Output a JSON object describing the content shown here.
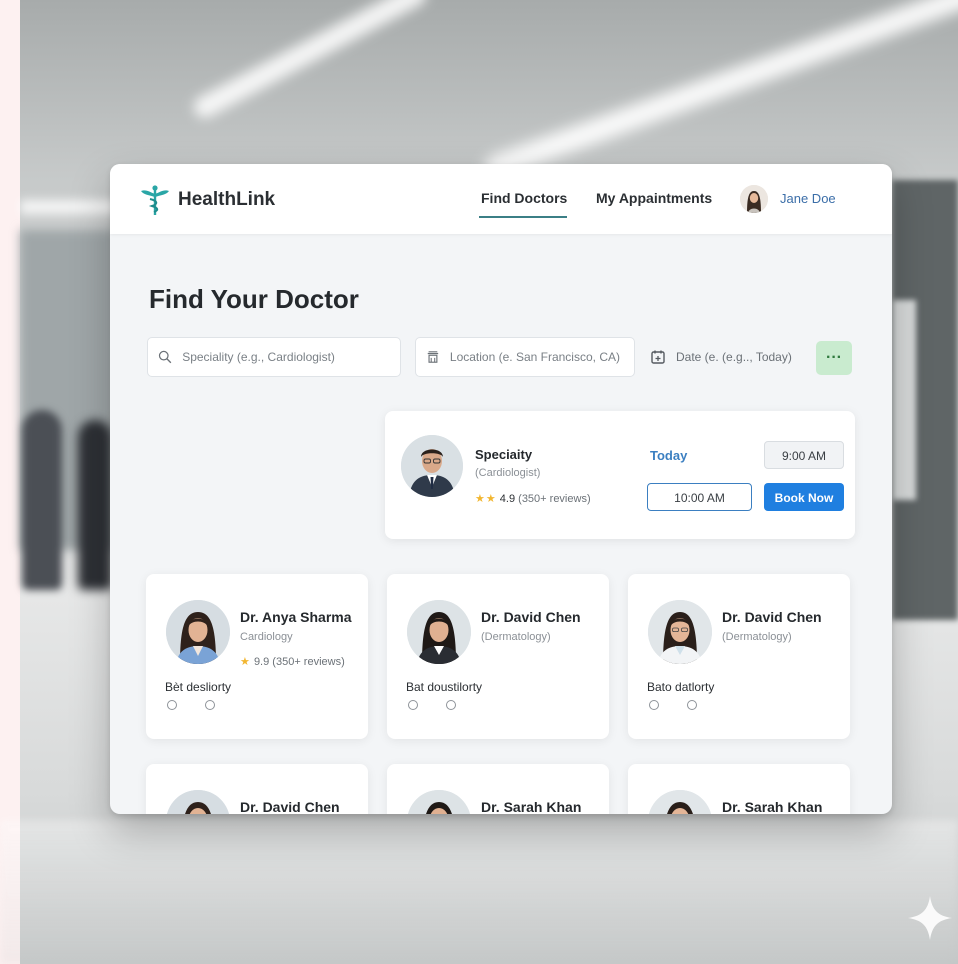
{
  "app": {
    "name": "HealthLink"
  },
  "nav": {
    "items": [
      {
        "label": "Find Doctors",
        "active": true
      },
      {
        "label": "My Appaintments",
        "active": false
      }
    ],
    "user": {
      "name": "Jane Doe"
    }
  },
  "page": {
    "title": "Find Your Doctor"
  },
  "search": {
    "specialty_placeholder": "Speciality (e.g., Cardiologist)",
    "location_placeholder": "Location (e. San Francisco, CA)",
    "date_placeholder": "Date (e. (e.g.., Today)",
    "more_label": "···"
  },
  "featured": {
    "title": "Speciaity",
    "subtitle": "(Cardiologist)",
    "stars": "★★",
    "rating": "4.9",
    "reviews": "(350+ reviews)",
    "day": "Today",
    "slot_1": "9:00 AM",
    "slot_2": "10:00 AM",
    "book_label": "Book Now"
  },
  "doctors": [
    {
      "name": "Dr. Anya Sharma",
      "specialty": "Cardiology",
      "stars": "★",
      "rating": "9.9",
      "reviews": "(350+ reviews)",
      "status": "Bèt desliorty"
    },
    {
      "name": "Dr. David Chen",
      "specialty": "(Dermatology)",
      "status": "Bat doustilorty"
    },
    {
      "name": "Dr. David Chen",
      "specialty": "(Dermatology)",
      "status": "Bato datlorty"
    },
    {
      "name": "Dr. David Chen"
    },
    {
      "name": "Dr. Sarah Khan"
    },
    {
      "name": "Dr. Sarah Khan"
    }
  ],
  "colors": {
    "brand_teal": "#2aa6a6",
    "accent_blue": "#1f7fe0",
    "star": "#f2b630",
    "more_button_bg": "#c9ebcf"
  }
}
